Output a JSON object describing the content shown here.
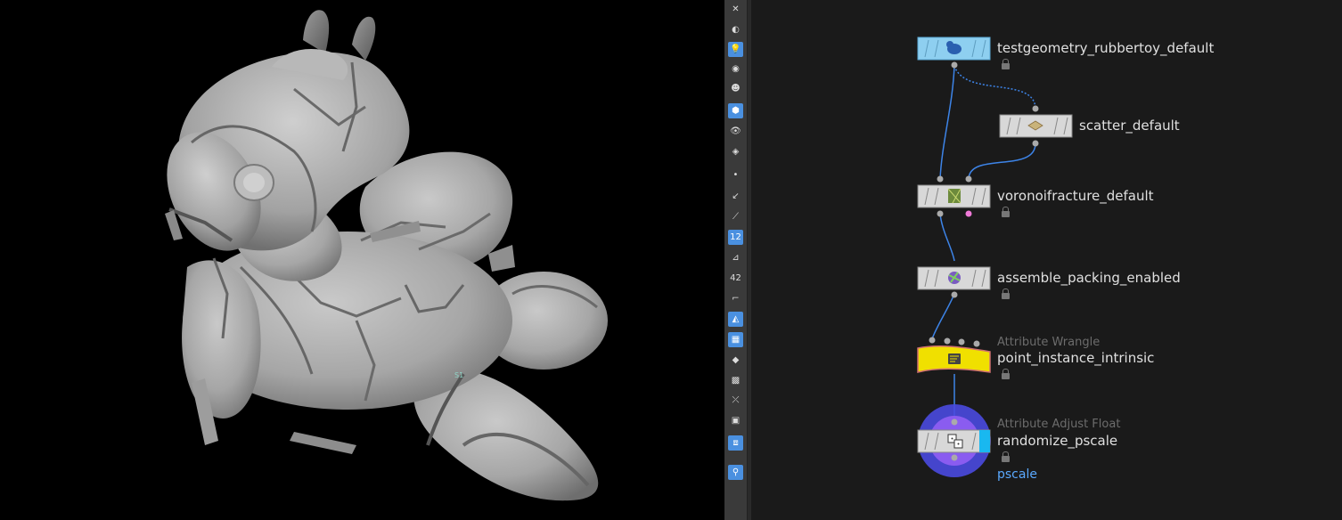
{
  "viewport": {
    "point_label": "S1",
    "colors": {
      "background": "#000000",
      "model": "#a9a9a9"
    }
  },
  "toolbar": {
    "tools": [
      {
        "name": "close-tool-icon",
        "glyph": "✕",
        "active": false
      },
      {
        "name": "selection-mask-icon",
        "glyph": "◐",
        "active": false
      },
      {
        "name": "light-bulb-icon",
        "glyph": "💡",
        "active": true
      },
      {
        "name": "light-alt-icon",
        "glyph": "◉",
        "active": false
      },
      {
        "name": "camera-light-icon",
        "glyph": "☻",
        "active": false
      },
      {
        "name": "display-mode-icon",
        "glyph": "⬢",
        "active": true
      },
      {
        "name": "eye-options-icon",
        "glyph": "👁",
        "active": false
      },
      {
        "name": "visibility-icon",
        "glyph": "◈",
        "active": false
      },
      {
        "name": "point-display-icon",
        "glyph": "•",
        "active": false
      },
      {
        "name": "normals-icon",
        "glyph": "↙",
        "active": false
      },
      {
        "name": "vectors-icon",
        "glyph": "⟋",
        "active": false
      },
      {
        "name": "point-numbers-icon",
        "glyph": "12",
        "active": true
      },
      {
        "name": "primitive-numbers-icon",
        "glyph": "⊿",
        "active": false
      },
      {
        "name": "vertex-numbers-icon",
        "glyph": "42",
        "active": false
      },
      {
        "name": "uv-border-icon",
        "glyph": "⌐",
        "active": false
      },
      {
        "name": "wireframe-icon",
        "glyph": "◭",
        "active": true
      },
      {
        "name": "ghost-icon",
        "glyph": "▦",
        "active": true
      },
      {
        "name": "shaded-icon",
        "glyph": "◆",
        "active": false
      },
      {
        "name": "texture-icon",
        "glyph": "▩",
        "active": false
      },
      {
        "name": "snap-icon",
        "glyph": "⤫",
        "active": false
      },
      {
        "name": "background-icon",
        "glyph": "▣",
        "active": false
      },
      {
        "name": "safe-area-icon",
        "glyph": "⧈",
        "active": true
      },
      {
        "name": "pin-icon",
        "glyph": "⚲",
        "active": true
      }
    ]
  },
  "network": {
    "colors": {
      "node_default": "#d8d8d8",
      "node_source": "#8ecff0",
      "node_wrangle": "#f0e000",
      "wire": "#3d84e8",
      "flag_blue": "#4a4ae0",
      "flag_purple": "#8a5cf0",
      "accent_cyan": "#19b8f0",
      "pink_output": "#f07ad8"
    },
    "nodes": [
      {
        "id": "testgeometry",
        "name": "testgeometry_rubbertoy_default",
        "type_label": "",
        "icon": "rubbertoy-icon"
      },
      {
        "id": "scatter",
        "name": "scatter_default",
        "type_label": "",
        "icon": "scatter-icon"
      },
      {
        "id": "voronoi",
        "name": "voronoifracture_default",
        "type_label": "",
        "icon": "voronoi-icon"
      },
      {
        "id": "assemble",
        "name": "assemble_packing_enabled",
        "type_label": "",
        "icon": "assemble-icon"
      },
      {
        "id": "wrangle",
        "name": "point_instance_intrinsic",
        "type_label": "Attribute Wrangle",
        "icon": "wrangle-icon"
      },
      {
        "id": "adjust",
        "name": "randomize_pscale",
        "type_label": "Attribute Adjust Float",
        "icon": "dice-icon",
        "flag_label": "pscale"
      }
    ]
  }
}
